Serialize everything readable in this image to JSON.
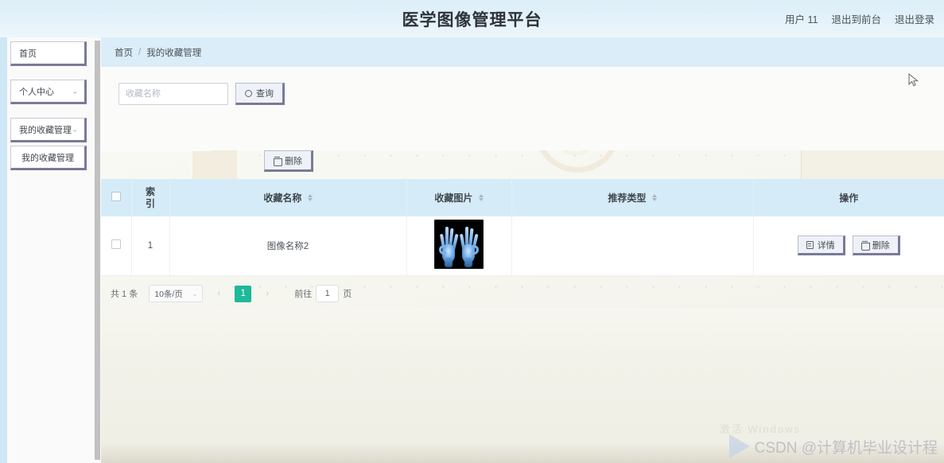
{
  "header": {
    "title": "医学图像管理平台",
    "links": [
      {
        "label": "用户 11",
        "name": "user-info"
      },
      {
        "label": "退出到前台",
        "name": "exit-to-frontend"
      },
      {
        "label": "退出登录",
        "name": "logout"
      }
    ]
  },
  "sidebar": {
    "items": [
      {
        "label": "首页",
        "chevron": "",
        "centered": false
      },
      {
        "label": "个人中心",
        "chevron": "⌄",
        "centered": false
      },
      {
        "label": "我的收藏管理",
        "chevron": "⌄",
        "centered": false
      },
      {
        "label": "我的收藏管理",
        "chevron": "",
        "centered": true
      }
    ]
  },
  "breadcrumb": {
    "home": "首页",
    "separator": "/",
    "current": "我的收藏管理"
  },
  "search": {
    "placeholder": "收藏名称",
    "value": "",
    "query_label": "查询",
    "query_icon": "search-icon"
  },
  "toolbar": {
    "delete_label": "删除",
    "delete_icon": "trash-icon"
  },
  "table": {
    "columns": [
      {
        "label": "",
        "name": "select-all",
        "sortable": false
      },
      {
        "label": "索\n引",
        "name": "index",
        "sortable": false
      },
      {
        "label": "收藏名称",
        "name": "favorite-name",
        "sortable": true
      },
      {
        "label": "收藏图片",
        "name": "favorite-image",
        "sortable": true
      },
      {
        "label": "推荐类型",
        "name": "recommend-type",
        "sortable": true
      },
      {
        "label": "操作",
        "name": "operation",
        "sortable": false
      }
    ],
    "column_index_line1": "索",
    "column_index_line2": "引",
    "column_name": "收藏名称",
    "column_image": "收藏图片",
    "column_type": "推荐类型",
    "column_op": "操作",
    "rows": [
      {
        "index": "1",
        "name": "图像名称2",
        "image_alt": "xray-hands-image",
        "type": "",
        "detail_label": "详情",
        "delete_label": "删除"
      }
    ]
  },
  "pagination": {
    "total_text": "共 1 条",
    "page_size": "10条/页",
    "prev": "‹",
    "next": "›",
    "current_page": "1",
    "jump_prefix": "前往",
    "jump_value": "1",
    "jump_suffix": "页"
  },
  "watermark": {
    "text": "CSDN @计算机毕业设计程",
    "ghost": "激活 Windows"
  },
  "colors": {
    "header_bg": "#dceef8",
    "breadcrumb_bg": "#dbedf8",
    "table_head_bg": "#d5ecf8",
    "accent_page": "#1cb99a",
    "button_bg": "#eef2f8",
    "button_shadow": "#7a7a96",
    "sidebar_bg": "#cfe6f5"
  }
}
